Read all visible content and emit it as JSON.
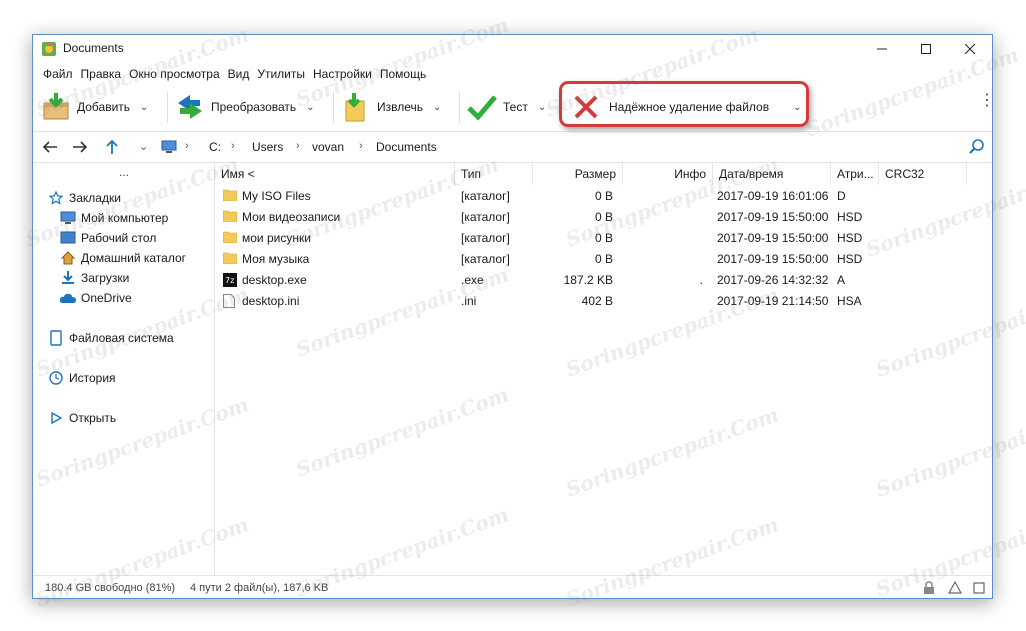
{
  "window": {
    "title": "Documents",
    "minimize_label": "—",
    "maximize_label": "☐",
    "close_label": "✕"
  },
  "menu": [
    "Файл",
    "Правка",
    "Окно просмотра",
    "Вид",
    "Утилиты",
    "Настройки",
    "Помощь"
  ],
  "toolbar": {
    "add": "Добавить",
    "convert": "Преобразовать",
    "extract": "Извлечь",
    "test": "Тест",
    "secure_delete": "Надёжное удаление файлов",
    "arrow": "⌄",
    "more": "⋮"
  },
  "address": {
    "crumbs": [
      "C:",
      "Users",
      "vovan",
      "Documents"
    ],
    "sep": "›",
    "dropdown": "⌄"
  },
  "sidebar": {
    "dots": "...",
    "bookmarks": "Закладки",
    "items": [
      "Мой компьютер",
      "Рабочий стол",
      "Домашний каталог",
      "Загрузки",
      "OneDrive"
    ],
    "filesystem": "Файловая система",
    "history": "История",
    "open": "Открыть"
  },
  "columns": [
    "Имя <",
    "Тип",
    "Размер",
    "Инфо",
    "Дата/время",
    "Атри...",
    "CRC32"
  ],
  "rows": [
    {
      "name": "My ISO Files",
      "type": "[каталог]",
      "size": "0 B",
      "info": "",
      "date": "2017-09-19 16:01:06",
      "attr": "D",
      "kind": "folder"
    },
    {
      "name": "Мои видеозаписи",
      "type": "[каталог]",
      "size": "0 B",
      "info": "",
      "date": "2017-09-19 15:50:00",
      "attr": "HSD",
      "kind": "folder"
    },
    {
      "name": "мои рисунки",
      "type": "[каталог]",
      "size": "0 B",
      "info": "",
      "date": "2017-09-19 15:50:00",
      "attr": "HSD",
      "kind": "folder"
    },
    {
      "name": "Моя музыка",
      "type": "[каталог]",
      "size": "0 B",
      "info": "",
      "date": "2017-09-19 15:50:00",
      "attr": "HSD",
      "kind": "folder"
    },
    {
      "name": "desktop.exe",
      "type": ".exe",
      "size": "187.2 KB",
      "info": ".",
      "date": "2017-09-26 14:32:32",
      "attr": "A",
      "kind": "exe"
    },
    {
      "name": "desktop.ini",
      "type": ".ini",
      "size": "402 B",
      "info": "",
      "date": "2017-09-19 21:14:50",
      "attr": "HSA",
      "kind": "ini"
    }
  ],
  "status": {
    "free": "180.4 GB свободно (81%)",
    "summary": "4 пути 2 файл(ы), 187,6 KB"
  },
  "watermark": "Soringpcrepair.Com",
  "colors": {
    "accent": "#1e73be",
    "highlight": "#d43a3a",
    "folder": "#f3c959",
    "green": "#2fae3a"
  },
  "icons": {
    "app": "app-logo-icon",
    "add": "add-archive-icon",
    "convert": "convert-icon",
    "extract": "extract-icon",
    "test": "checkmark-icon",
    "delete": "red-x-icon",
    "search": "search-icon",
    "lock": "lock-icon",
    "info": "info-icon"
  }
}
